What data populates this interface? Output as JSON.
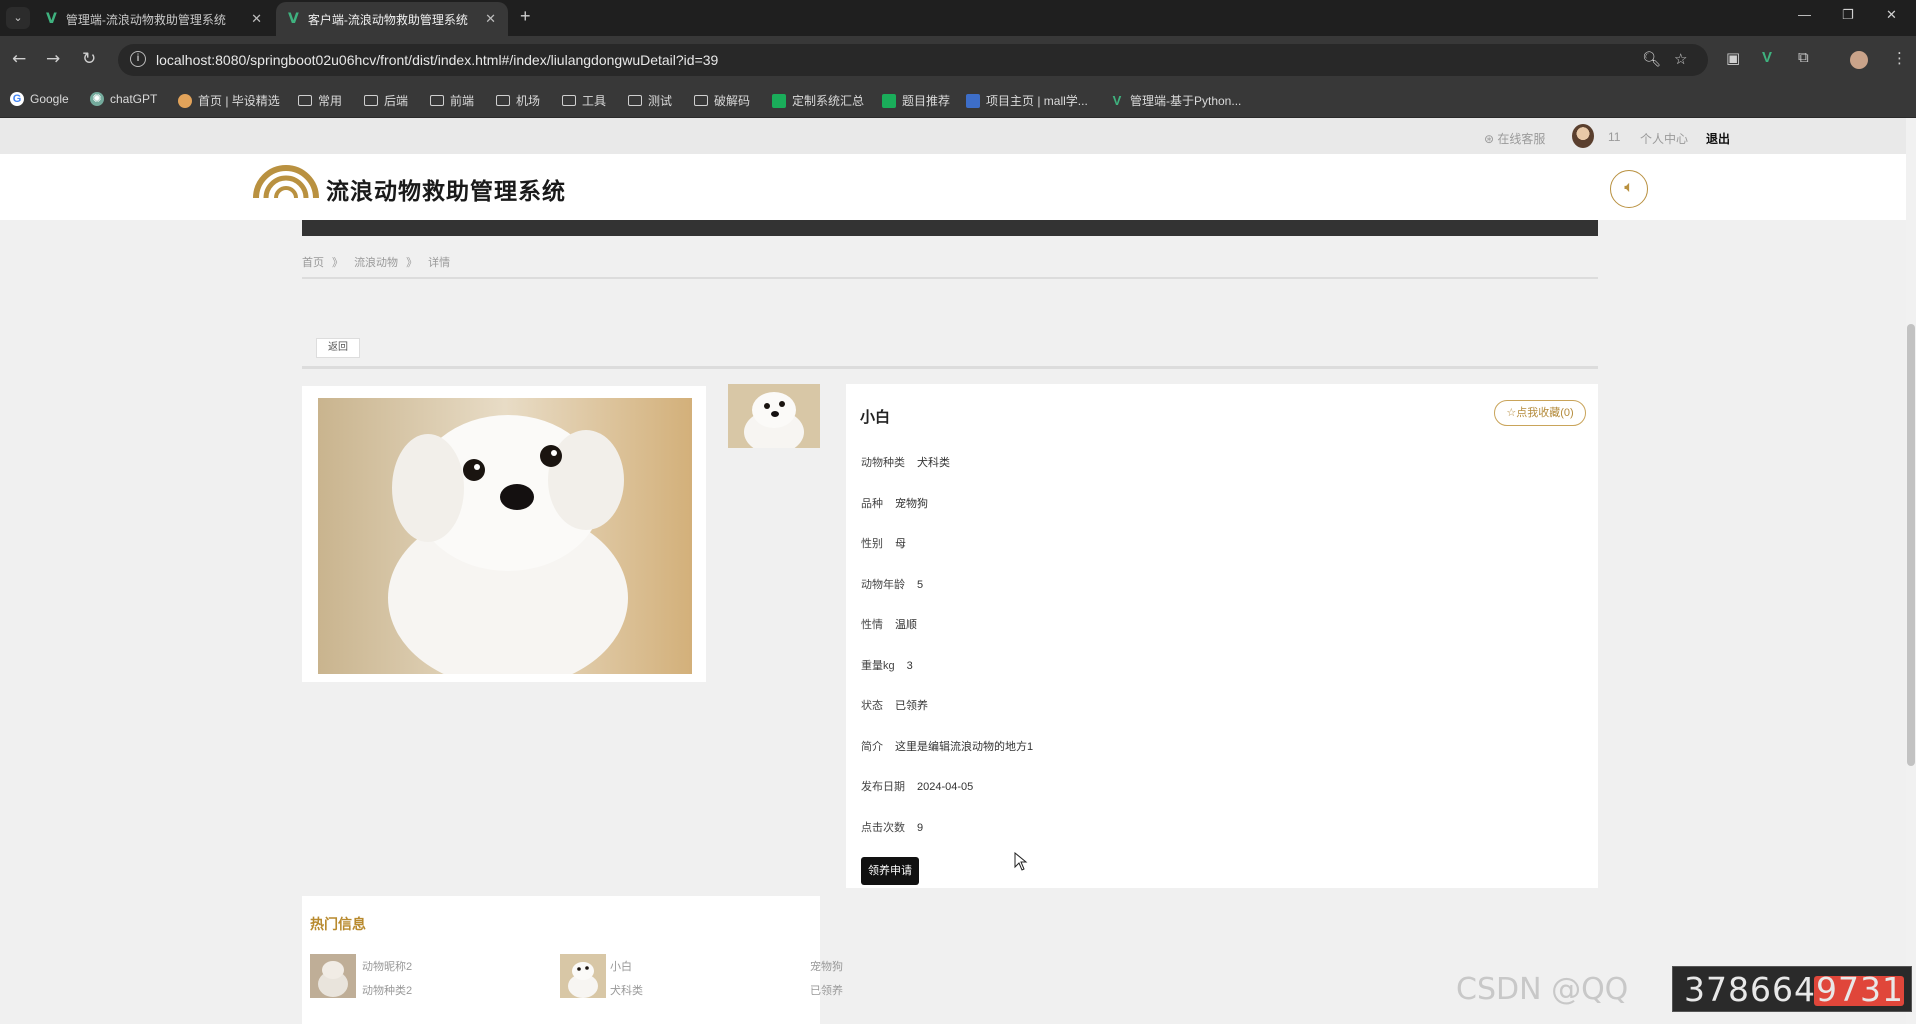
{
  "browser": {
    "tabs": [
      {
        "title": "管理端-流浪动物救助管理系统",
        "active": false
      },
      {
        "title": "客户端-流浪动物救助管理系统",
        "active": true
      }
    ],
    "url": "localhost:8080/springboot02u06hcv/front/dist/index.html#/index/liulangdongwuDetail?id=39",
    "bookmarks": [
      {
        "label": "Google",
        "icon": "google-icon"
      },
      {
        "label": "chatGPT",
        "icon": "chatgpt-icon"
      },
      {
        "label": "首页 | 毕设精选",
        "icon": "site-icon"
      },
      {
        "label": "常用",
        "icon": "folder-icon"
      },
      {
        "label": "后端",
        "icon": "folder-icon"
      },
      {
        "label": "前端",
        "icon": "folder-icon"
      },
      {
        "label": "机场",
        "icon": "folder-icon"
      },
      {
        "label": "工具",
        "icon": "folder-icon"
      },
      {
        "label": "测试",
        "icon": "folder-icon"
      },
      {
        "label": "破解码",
        "icon": "folder-icon"
      },
      {
        "label": "定制系统汇总",
        "icon": "sheet-icon"
      },
      {
        "label": "题目推荐",
        "icon": "sheet-icon"
      },
      {
        "label": "项目主页 | mall学...",
        "icon": "doc-icon"
      },
      {
        "label": "管理端-基于Python...",
        "icon": "vue-icon"
      }
    ]
  },
  "topstrip": {
    "service": "在线客服",
    "user": "11",
    "center": "个人中心",
    "logout": "退出"
  },
  "header": {
    "site_title": "流浪动物救助管理系统"
  },
  "breadcrumb": [
    "首页",
    "流浪动物",
    "详情"
  ],
  "back_label": "返回",
  "detail": {
    "name": "小白",
    "favorite_label": "☆点我收藏(0)",
    "fields": [
      {
        "label": "动物种类",
        "value": "犬科类"
      },
      {
        "label": "品种",
        "value": "宠物狗"
      },
      {
        "label": "性别",
        "value": "母"
      },
      {
        "label": "动物年龄",
        "value": "5"
      },
      {
        "label": "性情",
        "value": "温顺"
      },
      {
        "label": "重量kg",
        "value": "3"
      },
      {
        "label": "状态",
        "value": "已领养"
      },
      {
        "label": "简介",
        "value": "这里是编辑流浪动物的地方1"
      },
      {
        "label": "发布日期",
        "value": "2024-04-05"
      },
      {
        "label": "点击次数",
        "value": "9"
      }
    ],
    "adopt_label": "领养申请"
  },
  "hot": {
    "title": "热门信息",
    "items": [
      {
        "name": "动物昵称2",
        "kind": "动物种类2"
      },
      {
        "name": "小白",
        "kind": "犬科类",
        "breed": "宠物狗",
        "status": "已领养"
      }
    ]
  },
  "watermark": {
    "text": "CSDN @QQ",
    "number": "3786649731"
  },
  "colors": {
    "accent": "#b99140",
    "dark_nav": "#333333",
    "button": "#111111"
  }
}
